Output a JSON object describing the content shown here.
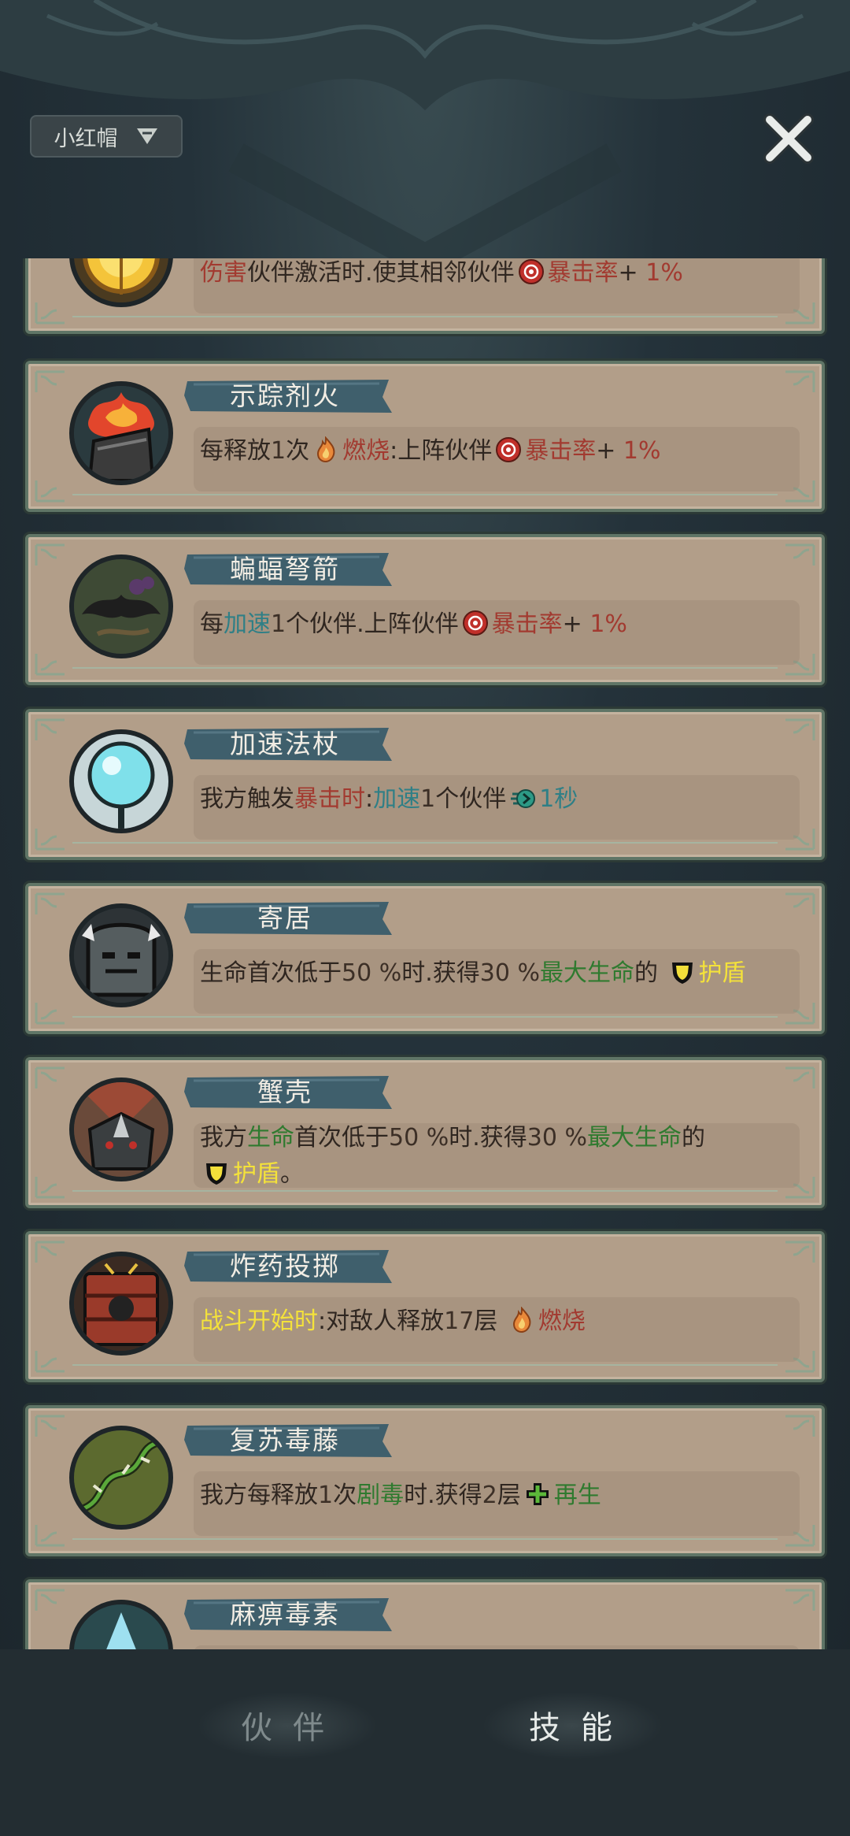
{
  "header": {
    "character_name": "小红帽",
    "close_label": "close"
  },
  "items": [
    {
      "title": "",
      "icon": "golden-target-icon",
      "desc": [
        {
          "t": "伤害",
          "c": "red"
        },
        {
          "t": "伙伴激活时.使其相邻伙伴",
          "c": ""
        },
        {
          "icon": "crit-icon"
        },
        {
          "t": "暴击率",
          "c": "red"
        },
        {
          "t": "+ ",
          "c": ""
        },
        {
          "t": "1%",
          "c": "red"
        }
      ]
    },
    {
      "title": "示踪剂火",
      "icon": "flaming-torch-icon",
      "desc": [
        {
          "t": "每释放",
          "c": ""
        },
        {
          "t": "1",
          "c": "num"
        },
        {
          "t": "次",
          "c": ""
        },
        {
          "icon": "burn-icon"
        },
        {
          "t": "燃烧",
          "c": "red"
        },
        {
          "t": ":上阵伙伴",
          "c": ""
        },
        {
          "icon": "crit-icon"
        },
        {
          "t": "暴击率",
          "c": "red"
        },
        {
          "t": "+ ",
          "c": ""
        },
        {
          "t": "1%",
          "c": "red"
        }
      ]
    },
    {
      "title": "蝙蝠弩箭",
      "icon": "bat-crossbow-icon",
      "desc": [
        {
          "t": "每",
          "c": ""
        },
        {
          "t": "加速",
          "c": "teal"
        },
        {
          "t": "1",
          "c": "num"
        },
        {
          "t": "个伙伴.上阵伙伴",
          "c": ""
        },
        {
          "icon": "crit-icon"
        },
        {
          "t": "暴击率",
          "c": "red"
        },
        {
          "t": "+ ",
          "c": ""
        },
        {
          "t": "1%",
          "c": "red"
        }
      ]
    },
    {
      "title": "加速法杖",
      "icon": "crystal-staff-icon",
      "desc": [
        {
          "t": "我方触发",
          "c": ""
        },
        {
          "t": "暴击时",
          "c": "red"
        },
        {
          "t": ":",
          "c": ""
        },
        {
          "t": "加速",
          "c": "teal"
        },
        {
          "t": "1",
          "c": "num"
        },
        {
          "t": "个伙伴",
          "c": ""
        },
        {
          "icon": "haste-icon"
        },
        {
          "t": "1秒",
          "c": "teal"
        }
      ]
    },
    {
      "title": "寄居",
      "icon": "iron-helmet-icon",
      "desc": [
        {
          "t": "生命首次低于",
          "c": ""
        },
        {
          "t": "50 %",
          "c": "num"
        },
        {
          "t": "时.获得",
          "c": ""
        },
        {
          "t": "30 %",
          "c": "num"
        },
        {
          "t": "最大生命",
          "c": "green"
        },
        {
          "t": "的 ",
          "c": ""
        },
        {
          "icon": "shield-icon"
        },
        {
          "t": "护盾",
          "c": "yellow"
        }
      ]
    },
    {
      "title": "蟹壳",
      "icon": "crab-shell-icon",
      "desc": [
        {
          "t": "我方",
          "c": ""
        },
        {
          "t": "生命",
          "c": "green"
        },
        {
          "t": "首次低于",
          "c": ""
        },
        {
          "t": "50 %",
          "c": "num"
        },
        {
          "t": "时.获得",
          "c": ""
        },
        {
          "t": "30 %",
          "c": "num"
        },
        {
          "t": "最大生命",
          "c": "green"
        },
        {
          "t": "的",
          "c": ""
        },
        {
          "br": true
        },
        {
          "icon": "shield-icon"
        },
        {
          "t": "护盾",
          "c": "yellow"
        },
        {
          "t": "。",
          "c": ""
        }
      ]
    },
    {
      "title": "炸药投掷",
      "icon": "dynamite-icon",
      "desc": [
        {
          "t": "战斗开始时",
          "c": "yellow"
        },
        {
          "t": ":对敌人释放",
          "c": ""
        },
        {
          "t": "17",
          "c": "num"
        },
        {
          "t": "层 ",
          "c": ""
        },
        {
          "icon": "burn-icon"
        },
        {
          "t": "燃烧",
          "c": "red"
        }
      ]
    },
    {
      "title": "复苏毒藤",
      "icon": "thorn-vine-icon",
      "desc": [
        {
          "t": "我方每释放",
          "c": ""
        },
        {
          "t": "1",
          "c": "num"
        },
        {
          "t": "次",
          "c": ""
        },
        {
          "t": "剧毒",
          "c": "green"
        },
        {
          "t": "时.获得",
          "c": ""
        },
        {
          "t": "2",
          "c": "num"
        },
        {
          "t": "层",
          "c": ""
        },
        {
          "icon": "regen-icon"
        },
        {
          "t": "再生",
          "c": "green"
        }
      ]
    },
    {
      "title": "麻痹毒素",
      "icon": "paralysis-toxin-icon",
      "desc": []
    }
  ],
  "tabs": [
    {
      "label": "伙伴",
      "active": false
    },
    {
      "label": "技能",
      "active": true
    }
  ],
  "colors": {
    "card_bg": "#b29e89",
    "card_border": "#5f7566",
    "red": "#a23a30",
    "teal": "#2f7f86",
    "green": "#2f7a2f",
    "yellow": "#f4e23a"
  }
}
